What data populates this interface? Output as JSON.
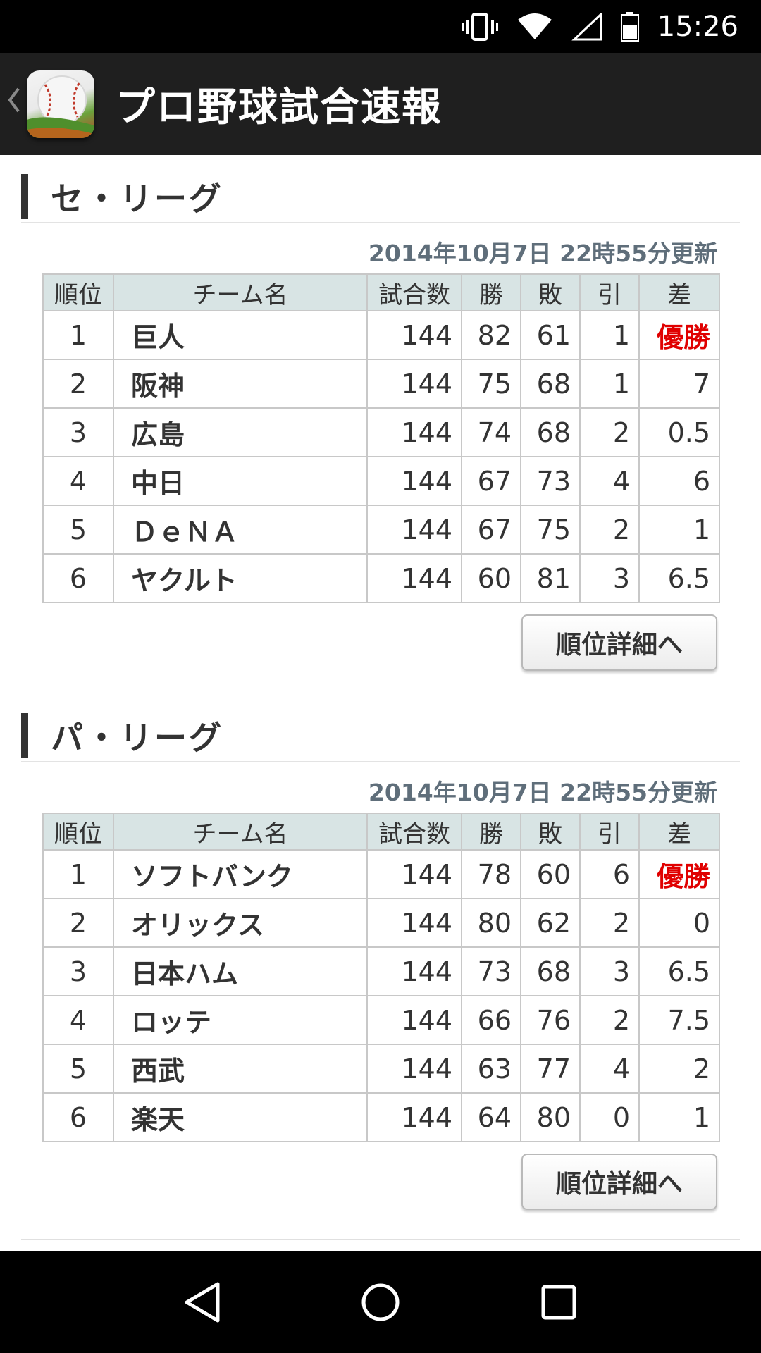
{
  "status_bar": {
    "time": "15:26",
    "icons": [
      "vibrate-icon",
      "wifi-icon",
      "signal-icon",
      "battery-icon"
    ]
  },
  "app_bar": {
    "title": "プロ野球試合速報",
    "icons": [
      "back-chevron-icon",
      "baseball-app-logo-icon"
    ]
  },
  "central": {
    "title": "セ・リーグ",
    "updated": "2014年10月7日 22時55分更新",
    "headers": [
      "順位",
      "チーム名",
      "試合数",
      "勝",
      "敗",
      "引",
      "差"
    ],
    "rows": [
      [
        "1",
        "巨人",
        "144",
        "82",
        "61",
        "1",
        "優勝"
      ],
      [
        "2",
        "阪神",
        "144",
        "75",
        "68",
        "1",
        "7"
      ],
      [
        "3",
        "広島",
        "144",
        "74",
        "68",
        "2",
        "0.5"
      ],
      [
        "4",
        "中日",
        "144",
        "67",
        "73",
        "4",
        "6"
      ],
      [
        "5",
        "ＤｅＮＡ",
        "144",
        "67",
        "75",
        "2",
        "1"
      ],
      [
        "6",
        "ヤクルト",
        "144",
        "60",
        "81",
        "3",
        "6.5"
      ]
    ],
    "button_label": "順位詳細へ"
  },
  "pacific": {
    "title": "パ・リーグ",
    "updated": "2014年10月7日 22時55分更新",
    "headers": [
      "順位",
      "チーム名",
      "試合数",
      "勝",
      "敗",
      "引",
      "差"
    ],
    "rows": [
      [
        "1",
        "ソフトバンク",
        "144",
        "78",
        "60",
        "6",
        "優勝"
      ],
      [
        "2",
        "オリックス",
        "144",
        "80",
        "62",
        "2",
        "0"
      ],
      [
        "3",
        "日本ハム",
        "144",
        "73",
        "68",
        "3",
        "6.5"
      ],
      [
        "4",
        "ロッテ",
        "144",
        "66",
        "76",
        "2",
        "7.5"
      ],
      [
        "5",
        "西武",
        "144",
        "63",
        "77",
        "4",
        "2"
      ],
      [
        "6",
        "楽天",
        "144",
        "64",
        "80",
        "0",
        "1"
      ]
    ],
    "button_label": "順位詳細へ"
  },
  "nav_bar": {
    "icons": [
      "back-triangle-icon",
      "home-circle-icon",
      "recents-square-icon"
    ]
  },
  "colors": {
    "team_link": "#1a45b8",
    "champion": "#e00000",
    "header_bg": "#d8e4e4",
    "updated_text": "#5f6e7a"
  }
}
